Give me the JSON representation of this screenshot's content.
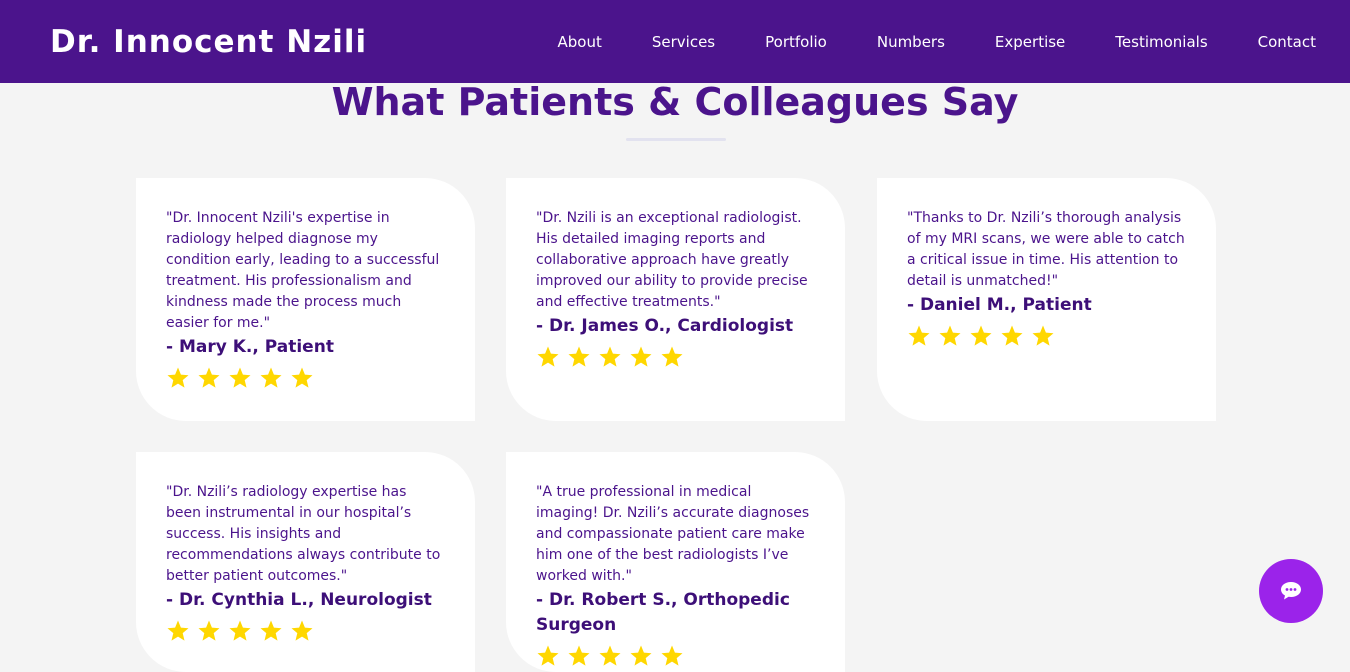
{
  "header": {
    "brand": "Dr. Innocent Nzili",
    "nav": [
      "About",
      "Services",
      "Portfolio",
      "Numbers",
      "Expertise",
      "Testimonials",
      "Contact"
    ]
  },
  "section": {
    "title": "What Patients & Colleagues Say"
  },
  "colors": {
    "primary": "#4b148c",
    "star": "#ffd700",
    "chat": "#9b23ea"
  },
  "testimonials": [
    {
      "quote": "\"Dr. Innocent Nzili's expertise in radiology helped diagnose my condition early, leading to a successful treatment. His professionalism and kindness made the process much easier for me.\"",
      "author": "- Mary K., Patient",
      "rating": 5
    },
    {
      "quote": "\"Dr. Nzili is an exceptional radiologist. His detailed imaging reports and collaborative approach have greatly improved our ability to provide precise and effective treatments.\"",
      "author": "- Dr. James O., Cardiologist",
      "rating": 5
    },
    {
      "quote": "\"Thanks to Dr. Nzili’s thorough analysis of my MRI scans, we were able to catch a critical issue in time. His attention to detail is unmatched!\"",
      "author": "- Daniel M., Patient",
      "rating": 5
    },
    {
      "quote": "\"Dr. Nzili’s radiology expertise has been instrumental in our hospital’s success. His insights and recommendations always contribute to better patient outcomes.\"",
      "author": "- Dr. Cynthia L., Neurologist",
      "rating": 5
    },
    {
      "quote": "\"A true professional in medical imaging! Dr. Nzili’s accurate diagnoses and compassionate patient care make him one of the best radiologists I’ve worked with.\"",
      "author": "- Dr. Robert S., Orthopedic Surgeon",
      "rating": 5
    }
  ],
  "chat": {
    "icon": "chat-bubble-icon"
  }
}
